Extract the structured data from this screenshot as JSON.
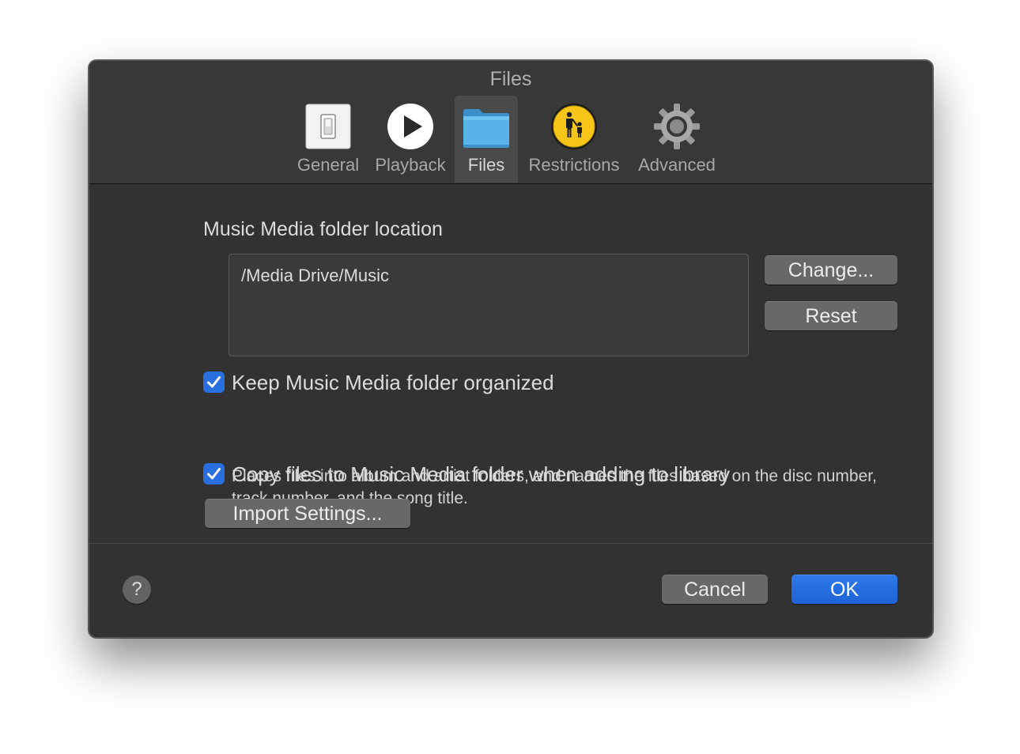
{
  "window": {
    "title": "Files"
  },
  "toolbar": {
    "items": [
      {
        "label": "General",
        "icon": "switch-icon"
      },
      {
        "label": "Playback",
        "icon": "play-icon"
      },
      {
        "label": "Files",
        "icon": "folder-icon",
        "selected": true
      },
      {
        "label": "Restrictions",
        "icon": "parental-controls-icon"
      },
      {
        "label": "Advanced",
        "icon": "gear-icon"
      }
    ]
  },
  "files": {
    "section_label": "Music Media folder location",
    "folder_path": "/Media Drive/Music",
    "change_label": "Change...",
    "reset_label": "Reset",
    "keep_organized": {
      "label": "Keep Music Media folder organized",
      "checked": true,
      "description": "Places files into album and artist folders, and names the files based on the disc number, track number, and the song title."
    },
    "copy_files": {
      "label": "Copy files to Music Media folder when adding to library",
      "checked": true
    },
    "import_settings_label": "Import Settings..."
  },
  "footer": {
    "help_label": "?",
    "cancel_label": "Cancel",
    "ok_label": "OK"
  },
  "colors": {
    "window_bg": "#323232",
    "accent": "#2a6fe0",
    "text": "#dcdcdc"
  }
}
